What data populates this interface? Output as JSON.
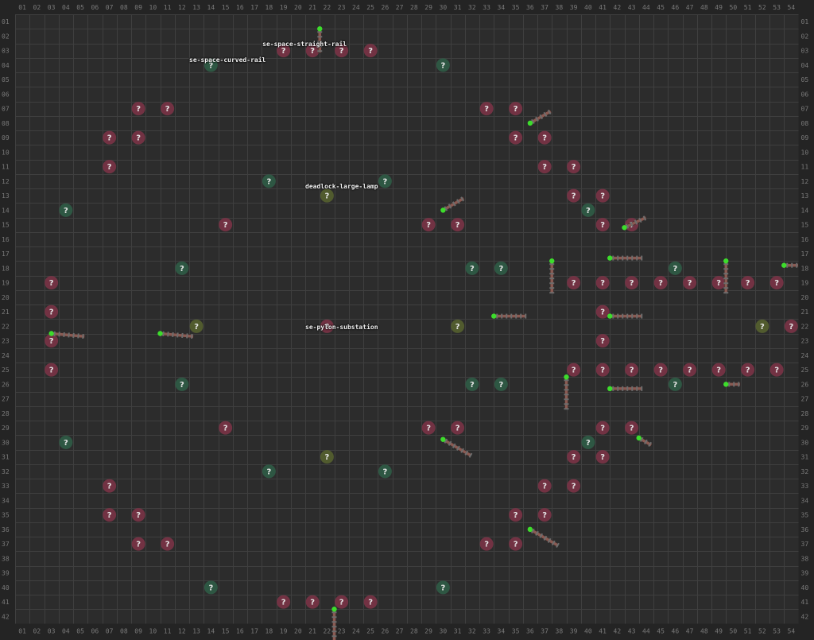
{
  "labels": [
    {
      "text": "se-space-straight-rail",
      "col": 18.05,
      "row": 3.1
    },
    {
      "text": "se-space-curved-rail",
      "col": 13.0,
      "row": 4.2
    },
    {
      "text": "deadlock-large-lamp",
      "col": 21.0,
      "row": 12.9
    },
    {
      "text": "se-pylon-substation",
      "col": 21.0,
      "row": 22.6
    }
  ],
  "colors": {
    "background": "#2c2c2c",
    "grid_line": "#3f3f3f",
    "ruler": "#242424",
    "unknown_red": "#7a3346",
    "unknown_green": "#2f5c46",
    "unknown_olive": "#55602f",
    "rail": "#8a5a52",
    "signal_green": "#3ddc2c"
  },
  "grid": {
    "columns": 54,
    "rows": 42
  },
  "unknown_red": [
    [
      19,
      3
    ],
    [
      21,
      3
    ],
    [
      23,
      3
    ],
    [
      25,
      3
    ],
    [
      9,
      7
    ],
    [
      11,
      7
    ],
    [
      33,
      7
    ],
    [
      35,
      7
    ],
    [
      7,
      9
    ],
    [
      9,
      9
    ],
    [
      35,
      9
    ],
    [
      37,
      9
    ],
    [
      7,
      11
    ],
    [
      37,
      11
    ],
    [
      39,
      11
    ],
    [
      39,
      13
    ],
    [
      41,
      13
    ],
    [
      15,
      15
    ],
    [
      29,
      15
    ],
    [
      31,
      15
    ],
    [
      41,
      15
    ],
    [
      43,
      15
    ],
    [
      3,
      19
    ],
    [
      39,
      19
    ],
    [
      41,
      19
    ],
    [
      43,
      19
    ],
    [
      45,
      19
    ],
    [
      47,
      19
    ],
    [
      49,
      19
    ],
    [
      51,
      19
    ],
    [
      53,
      19
    ],
    [
      3,
      21
    ],
    [
      41,
      21
    ],
    [
      3,
      23
    ],
    [
      22,
      22
    ],
    [
      54,
      22
    ],
    [
      41,
      23
    ],
    [
      3,
      25
    ],
    [
      39,
      25
    ],
    [
      41,
      25
    ],
    [
      43,
      25
    ],
    [
      45,
      25
    ],
    [
      47,
      25
    ],
    [
      49,
      25
    ],
    [
      51,
      25
    ],
    [
      53,
      25
    ],
    [
      15,
      29
    ],
    [
      29,
      29
    ],
    [
      31,
      29
    ],
    [
      41,
      29
    ],
    [
      43,
      29
    ],
    [
      39,
      31
    ],
    [
      41,
      31
    ],
    [
      7,
      33
    ],
    [
      37,
      33
    ],
    [
      39,
      33
    ],
    [
      7,
      35
    ],
    [
      9,
      35
    ],
    [
      35,
      35
    ],
    [
      37,
      35
    ],
    [
      9,
      37
    ],
    [
      11,
      37
    ],
    [
      33,
      37
    ],
    [
      35,
      37
    ],
    [
      19,
      41
    ],
    [
      21,
      41
    ],
    [
      23,
      41
    ],
    [
      25,
      41
    ]
  ],
  "unknown_green": [
    [
      14,
      4
    ],
    [
      30,
      4
    ],
    [
      18,
      12
    ],
    [
      26,
      12
    ],
    [
      4,
      14
    ],
    [
      40,
      14
    ],
    [
      12,
      18
    ],
    [
      32,
      18
    ],
    [
      34,
      18
    ],
    [
      46,
      18
    ],
    [
      12,
      26
    ],
    [
      32,
      26
    ],
    [
      34,
      26
    ],
    [
      46,
      26
    ],
    [
      4,
      30
    ],
    [
      40,
      30
    ],
    [
      18,
      32
    ],
    [
      26,
      32
    ],
    [
      14,
      40
    ],
    [
      30,
      40
    ]
  ],
  "unknown_olive": [
    [
      22,
      13
    ],
    [
      13,
      22
    ],
    [
      31,
      22
    ],
    [
      52,
      22
    ],
    [
      22,
      31
    ]
  ],
  "rails": [
    {
      "col": 21.5,
      "row": 1.5,
      "len": 30,
      "angle": 90
    },
    {
      "col": 36.0,
      "row": 8.0,
      "len": 30,
      "angle": -30
    },
    {
      "col": 30.0,
      "row": 14.0,
      "len": 30,
      "angle": -30
    },
    {
      "col": 42.5,
      "row": 15.2,
      "len": 30,
      "angle": -25
    },
    {
      "col": 37.5,
      "row": 17.5,
      "len": 40,
      "angle": 90
    },
    {
      "col": 41.5,
      "row": 17.3,
      "len": 40,
      "angle": 0
    },
    {
      "col": 49.5,
      "row": 17.5,
      "len": 40,
      "angle": 90
    },
    {
      "col": 53.5,
      "row": 17.8,
      "len": 18,
      "angle": 0
    },
    {
      "col": 3.0,
      "row": 22.5,
      "len": 42,
      "angle": 5
    },
    {
      "col": 10.5,
      "row": 22.5,
      "len": 42,
      "angle": 5
    },
    {
      "col": 33.5,
      "row": 21.3,
      "len": 40,
      "angle": 0
    },
    {
      "col": 41.5,
      "row": 21.3,
      "len": 40,
      "angle": 0
    },
    {
      "col": 38.5,
      "row": 25.5,
      "len": 40,
      "angle": 90
    },
    {
      "col": 41.5,
      "row": 26.3,
      "len": 40,
      "angle": 0
    },
    {
      "col": 49.5,
      "row": 26.0,
      "len": 18,
      "angle": 0
    },
    {
      "col": 30.0,
      "row": 29.8,
      "len": 40,
      "angle": 30
    },
    {
      "col": 43.5,
      "row": 29.7,
      "len": 18,
      "angle": 30
    },
    {
      "col": 36.0,
      "row": 36.0,
      "len": 40,
      "angle": 30
    },
    {
      "col": 22.5,
      "row": 41.5,
      "len": 40,
      "angle": 90
    }
  ]
}
